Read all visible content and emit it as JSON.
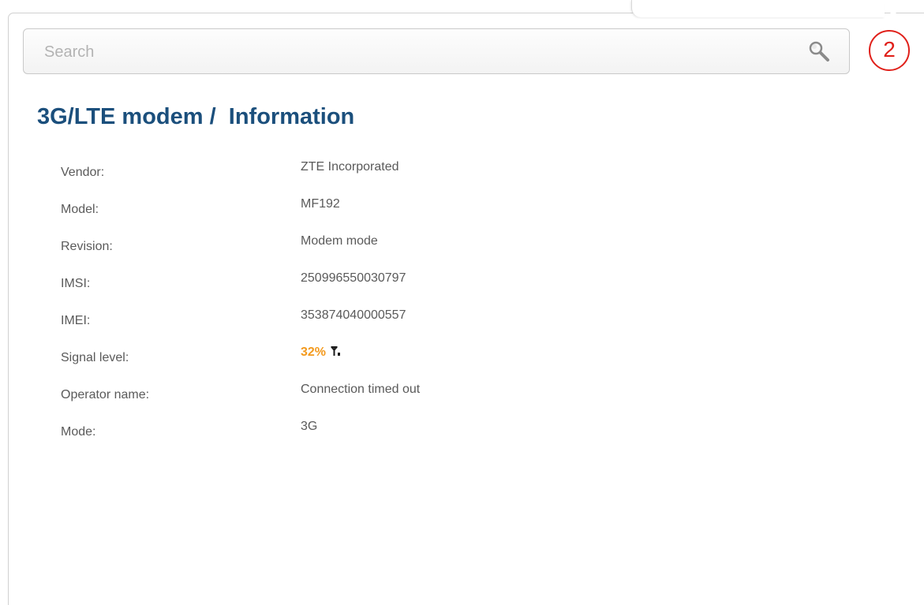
{
  "search": {
    "placeholder": "Search",
    "icon": "search-icon"
  },
  "step_badge": {
    "label": "2",
    "color": "#e0201a"
  },
  "page": {
    "title": "3G/LTE modem /  Information",
    "title_color": "#1b4f7c"
  },
  "info": {
    "vendor": {
      "label": "Vendor:",
      "value": "ZTE Incorporated"
    },
    "model": {
      "label": "Model:",
      "value": "MF192"
    },
    "revision": {
      "label": "Revision:",
      "value": "Modem mode"
    },
    "imsi": {
      "label": "IMSI:",
      "value": "250996550030797"
    },
    "imei": {
      "label": "IMEI:",
      "value": "353874040000557"
    },
    "signal_level": {
      "label": "Signal level:",
      "value": "32%",
      "level_percent": 32,
      "value_color": "#f39a1e",
      "icon": "signal-strength-icon"
    },
    "operator_name": {
      "label": "Operator name:",
      "value": "Connection timed out"
    },
    "mode": {
      "label": "Mode:",
      "value": "3G"
    }
  }
}
